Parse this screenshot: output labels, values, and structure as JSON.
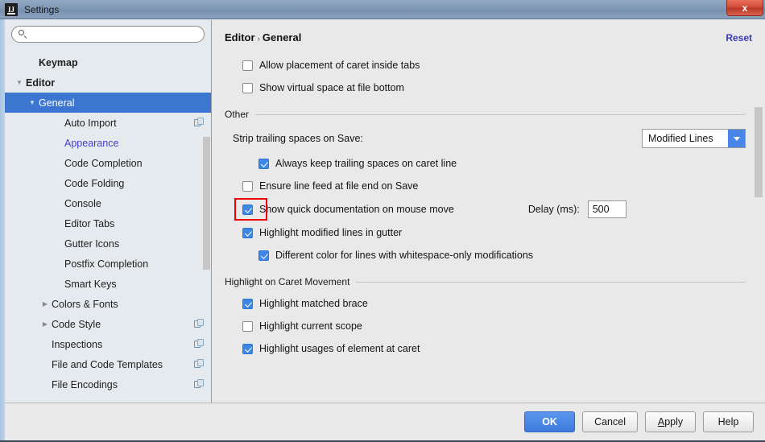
{
  "window": {
    "title": "Settings",
    "app_icon": "intellij-idea-icon",
    "close_label": "x",
    "accent_color": "#3d76d0",
    "titlebar_color": "#7e97b4",
    "highlight_color": "#ee0000"
  },
  "sidebar": {
    "search": {
      "value": "",
      "placeholder": "",
      "icon": "search-icon"
    },
    "items": [
      {
        "label": "Keymap",
        "indent": 1,
        "twisty": "",
        "bold": true,
        "selected": false,
        "modified": false,
        "copy_icon": false
      },
      {
        "label": "Editor",
        "indent": 0,
        "twisty": "▼",
        "bold": true,
        "selected": false,
        "modified": false,
        "copy_icon": false
      },
      {
        "label": "General",
        "indent": 1,
        "twisty": "▼",
        "bold": false,
        "selected": true,
        "modified": false,
        "copy_icon": false
      },
      {
        "label": "Auto Import",
        "indent": 3,
        "twisty": "",
        "bold": false,
        "selected": false,
        "modified": false,
        "copy_icon": true
      },
      {
        "label": "Appearance",
        "indent": 3,
        "twisty": "",
        "bold": false,
        "selected": false,
        "modified": true,
        "copy_icon": false
      },
      {
        "label": "Code Completion",
        "indent": 3,
        "twisty": "",
        "bold": false,
        "selected": false,
        "modified": false,
        "copy_icon": false
      },
      {
        "label": "Code Folding",
        "indent": 3,
        "twisty": "",
        "bold": false,
        "selected": false,
        "modified": false,
        "copy_icon": false
      },
      {
        "label": "Console",
        "indent": 3,
        "twisty": "",
        "bold": false,
        "selected": false,
        "modified": false,
        "copy_icon": false
      },
      {
        "label": "Editor Tabs",
        "indent": 3,
        "twisty": "",
        "bold": false,
        "selected": false,
        "modified": false,
        "copy_icon": false
      },
      {
        "label": "Gutter Icons",
        "indent": 3,
        "twisty": "",
        "bold": false,
        "selected": false,
        "modified": false,
        "copy_icon": false
      },
      {
        "label": "Postfix Completion",
        "indent": 3,
        "twisty": "",
        "bold": false,
        "selected": false,
        "modified": false,
        "copy_icon": false
      },
      {
        "label": "Smart Keys",
        "indent": 3,
        "twisty": "",
        "bold": false,
        "selected": false,
        "modified": false,
        "copy_icon": false
      },
      {
        "label": "Colors & Fonts",
        "indent": 2,
        "twisty": "▶",
        "bold": false,
        "selected": false,
        "modified": false,
        "copy_icon": false
      },
      {
        "label": "Code Style",
        "indent": 2,
        "twisty": "▶",
        "bold": false,
        "selected": false,
        "modified": false,
        "copy_icon": true
      },
      {
        "label": "Inspections",
        "indent": 2,
        "twisty": "",
        "bold": false,
        "selected": false,
        "modified": false,
        "copy_icon": true
      },
      {
        "label": "File and Code Templates",
        "indent": 2,
        "twisty": "",
        "bold": false,
        "selected": false,
        "modified": false,
        "copy_icon": true
      },
      {
        "label": "File Encodings",
        "indent": 2,
        "twisty": "",
        "bold": false,
        "selected": false,
        "modified": false,
        "copy_icon": true
      }
    ]
  },
  "main": {
    "breadcrumb": {
      "parent": "Editor",
      "separator": "›",
      "current": "General"
    },
    "reset_label": "Reset",
    "top_checkboxes": [
      {
        "label": "Allow placement of caret inside tabs",
        "checked": false
      },
      {
        "label": "Show virtual space at file bottom",
        "checked": false
      }
    ],
    "section_other": {
      "title": "Other",
      "strip_label": "Strip trailing spaces on Save:",
      "strip_value": "Modified Lines",
      "checkboxes": [
        {
          "label": "Always keep trailing spaces on caret line",
          "checked": true
        },
        {
          "label": "Ensure line feed at file end on Save",
          "checked": false
        },
        {
          "label": "Show quick documentation on mouse move",
          "checked": true
        },
        {
          "label": "Highlight modified lines in gutter",
          "checked": true
        },
        {
          "label": "Different color for lines with whitespace-only modifications",
          "checked": true
        }
      ],
      "delay_label": "Delay (ms):",
      "delay_value": "500"
    },
    "section_caret": {
      "title": "Highlight on Caret Movement",
      "checkboxes": [
        {
          "label": "Highlight matched brace",
          "checked": true
        },
        {
          "label": "Highlight current scope",
          "checked": false
        },
        {
          "label": "Highlight usages of element at caret",
          "checked": true
        }
      ]
    }
  },
  "footer": {
    "ok": "OK",
    "cancel": "Cancel",
    "apply_prefix": "A",
    "apply_rest": "pply",
    "help": "Help"
  }
}
